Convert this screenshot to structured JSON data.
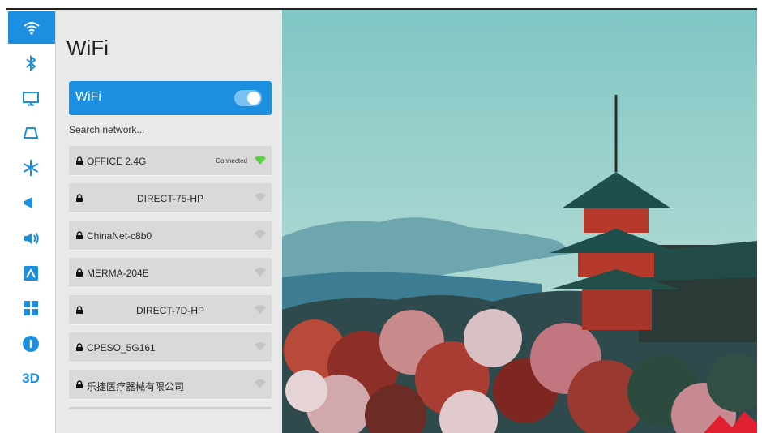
{
  "panel": {
    "title": "WiFi",
    "wifi_toggle_label": "WiFi",
    "wifi_enabled": true,
    "search_label": "Search network..."
  },
  "networks": [
    {
      "name": "OFFICE 2.4G",
      "status": "Connected",
      "locked": true,
      "centered": false
    },
    {
      "name": "DIRECT-75-HP",
      "status": "",
      "locked": true,
      "centered": true
    },
    {
      "name": "ChinaNet-c8b0",
      "status": "",
      "locked": true,
      "centered": false
    },
    {
      "name": "MERMA-204E",
      "status": "",
      "locked": true,
      "centered": false
    },
    {
      "name": "DIRECT-7D-HP",
      "status": "",
      "locked": true,
      "centered": true
    },
    {
      "name": "CPESO_5G161",
      "status": "",
      "locked": true,
      "centered": false
    },
    {
      "name": "乐捷医疗器械有限公司",
      "status": "",
      "locked": true,
      "centered": false
    }
  ],
  "rail": {
    "items": [
      "wifi",
      "bluetooth",
      "display",
      "projector",
      "snowflake",
      "megaphone",
      "sound",
      "photo",
      "apps",
      "info"
    ],
    "three_d_label": "3D",
    "active_item": "wifi"
  },
  "colors": {
    "accent": "#1d8fe0",
    "panel_bg": "#e9e9e9",
    "row_bg": "#d9d9d9",
    "connected_signal": "#5fcf4a"
  }
}
